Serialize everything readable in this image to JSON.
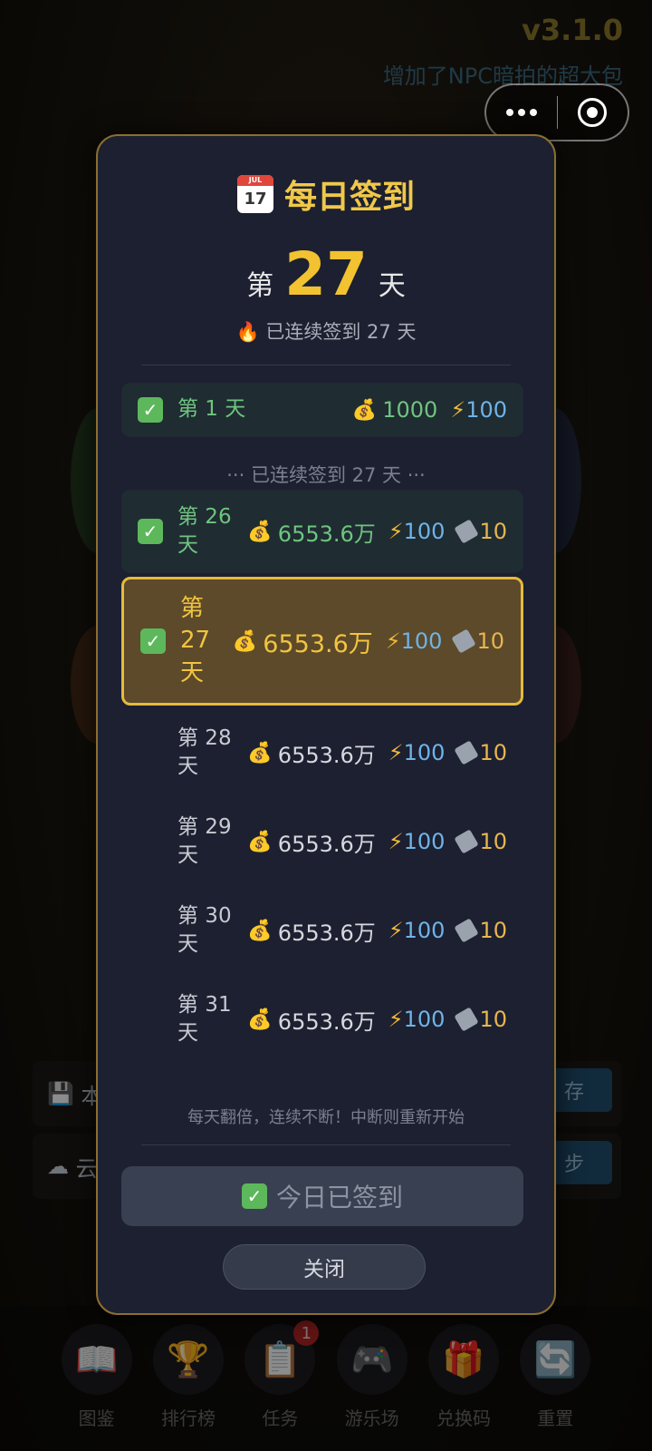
{
  "app": {
    "version": "v3.1.0",
    "notice": "增加了NPC暗拍的超大包"
  },
  "background": {
    "local_save_label": "本",
    "local_save_button": "存",
    "cloud_sync_label": "云",
    "cloud_sync_button": "步"
  },
  "bottom_nav": [
    {
      "label": "图鉴",
      "icon": "book-icon",
      "glyph": "📖"
    },
    {
      "label": "排行榜",
      "icon": "trophy-icon",
      "glyph": "🏆"
    },
    {
      "label": "任务",
      "icon": "clipboard-icon",
      "glyph": "📋",
      "badge": "1"
    },
    {
      "label": "游乐场",
      "icon": "gamepad-icon",
      "glyph": "🎮"
    },
    {
      "label": "兑换码",
      "icon": "gift-icon",
      "glyph": "🎁"
    },
    {
      "label": "重置",
      "icon": "refresh-icon",
      "glyph": "🔄"
    }
  ],
  "modal": {
    "title": "每日签到",
    "calendar_month": "JUL",
    "calendar_day": "17",
    "day_prefix": "第",
    "day_number": "27",
    "day_suffix": "天",
    "streak_text": "🔥 已连续签到 27 天",
    "gap_text": "··· 已连续签到 27 天 ···",
    "footer_note": "每天翻倍，连续不断！中断则重新开始",
    "signed_label": "今日已签到",
    "close_label": "关闭",
    "rows": [
      {
        "day": "第 1 天",
        "money": "1000",
        "energy": "100",
        "tickets": null,
        "status": "done"
      },
      {
        "day": "第 26 天",
        "money": "6553.6万",
        "energy": "100",
        "tickets": "10",
        "status": "done"
      },
      {
        "day": "第 27 天",
        "money": "6553.6万",
        "energy": "100",
        "tickets": "10",
        "status": "today"
      },
      {
        "day": "第 28 天",
        "money": "6553.6万",
        "energy": "100",
        "tickets": "10",
        "status": "future"
      },
      {
        "day": "第 29 天",
        "money": "6553.6万",
        "energy": "100",
        "tickets": "10",
        "status": "future"
      },
      {
        "day": "第 30 天",
        "money": "6553.6万",
        "energy": "100",
        "tickets": "10",
        "status": "future"
      },
      {
        "day": "第 31 天",
        "money": "6553.6万",
        "energy": "100",
        "tickets": "10",
        "status": "future"
      }
    ]
  },
  "colors": {
    "accent_gold": "#f2c230",
    "done_green": "#6fc47f",
    "energy_blue": "#6fb3e8",
    "modal_bg": "#1c2030"
  }
}
